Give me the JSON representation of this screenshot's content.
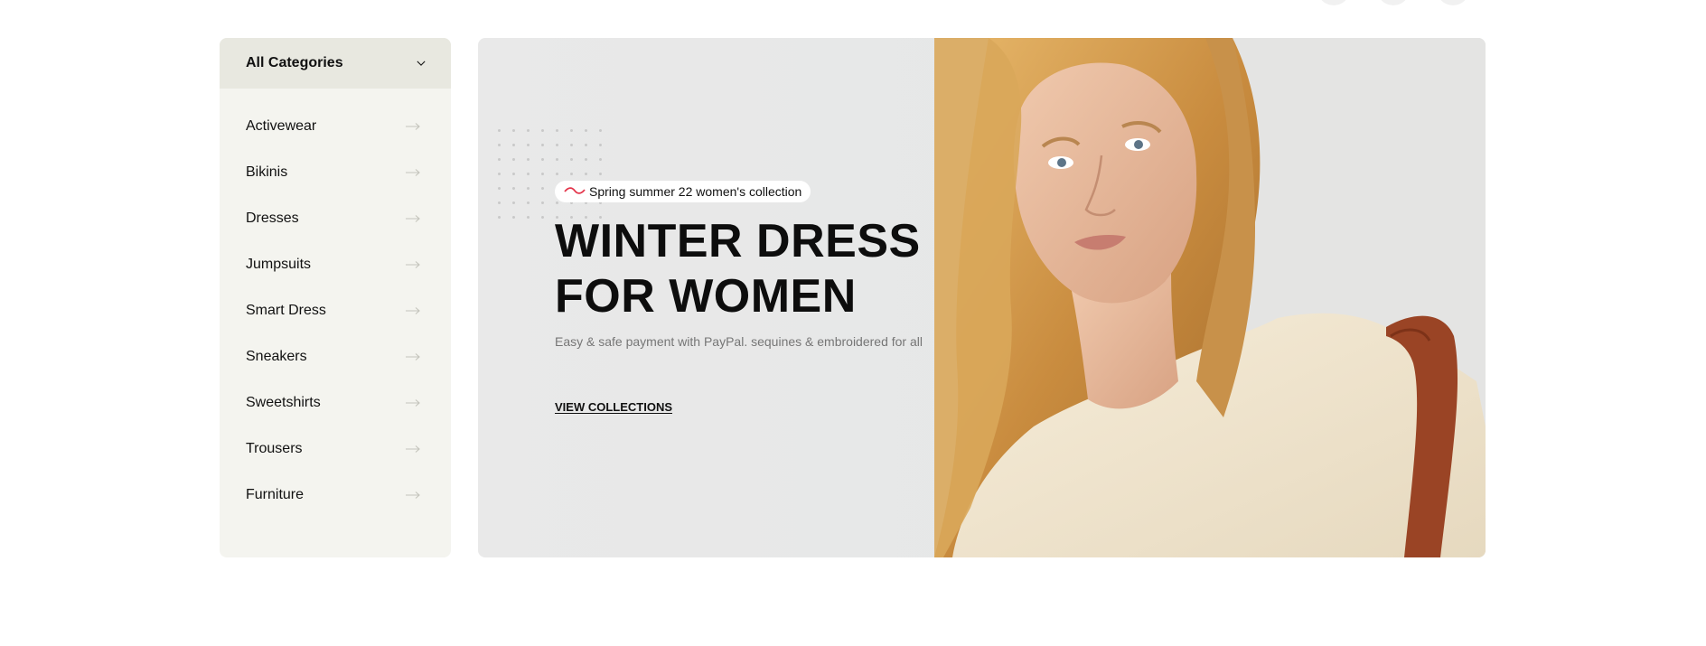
{
  "sidebar": {
    "title": "All Categories",
    "items": [
      {
        "label": "Activewear"
      },
      {
        "label": "Bikinis"
      },
      {
        "label": "Dresses"
      },
      {
        "label": "Jumpsuits"
      },
      {
        "label": "Smart Dress"
      },
      {
        "label": "Sneakers"
      },
      {
        "label": "Sweetshirts"
      },
      {
        "label": "Trousers"
      },
      {
        "label": "Furniture"
      }
    ]
  },
  "hero": {
    "badge": "Spring summer 22 women's collection",
    "headline_line1": "WINTER DRESS",
    "headline_line2": "FOR WOMEN",
    "subtext": "Easy & safe payment with PayPal. sequines & embroidered for all",
    "cta": "VIEW COLLECTIONS",
    "image": "woman-model-photo"
  },
  "icons": {
    "dropdown": "chevron-down-icon",
    "item_arrow": "arrow-right-icon",
    "badge_mark": "wave-icon"
  },
  "colors": {
    "sidebar_bg": "#f4f4ef",
    "sidebar_header_bg": "#e8e8e0",
    "hero_bg": "#e7e7e7",
    "badge_accent": "#e3344a"
  }
}
